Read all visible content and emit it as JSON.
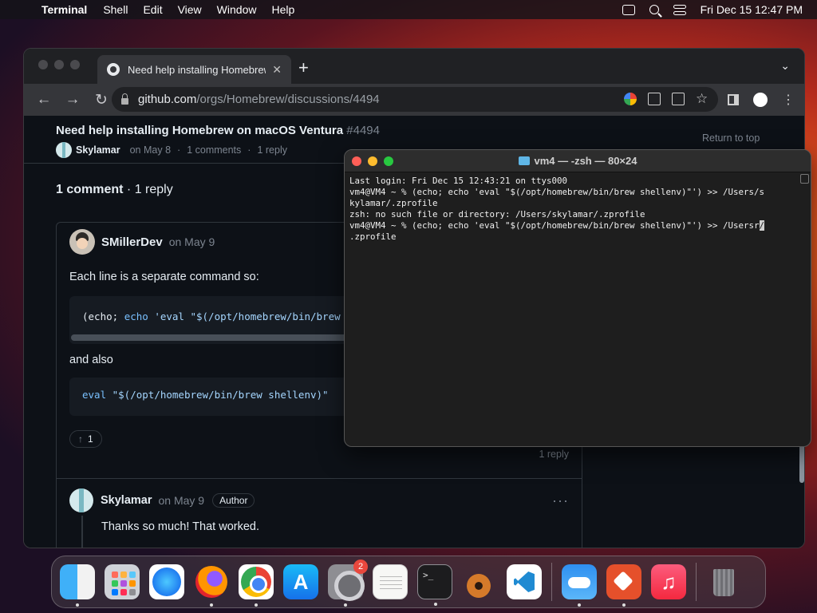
{
  "menubar": {
    "app_name": "Terminal",
    "menus": [
      "Shell",
      "Edit",
      "View",
      "Window",
      "Help"
    ],
    "clock": "Fri Dec 15  12:47 PM"
  },
  "browser": {
    "tab_title": "Need help installing Homebrew",
    "new_tab_label": "+",
    "url_host": "github.com",
    "url_path": "/orgs/Homebrew/discussions/4494"
  },
  "discussion": {
    "title": "Need help installing Homebrew on macOS Ventura",
    "number": "#4494",
    "author": "Skylamar",
    "date": "on May 8",
    "comments": "1 comments",
    "replies": "1 reply",
    "return_to_top": "Return to top",
    "count_bold": "1 comment",
    "count_rest": " · 1 reply"
  },
  "comment": {
    "user": "SMillerDev",
    "date": "on May 9",
    "text1": "Each line is a separate command so:",
    "code1_paren": "(echo; ",
    "code1_echo": "echo",
    "code1_rest": " 'eval \"$(/opt/homebrew/bin/brew shellenv)\"') >> /Users/skylamar/.zprofile",
    "text2": "and also",
    "code2_eval": "eval",
    "code2_rest": " \"$(/opt/homebrew/bin/brew shellenv)\"",
    "reaction_arrow": "↑",
    "reaction_count": "1",
    "reply_count": "1 reply"
  },
  "reply": {
    "user": "Skylamar",
    "date": "on May 9",
    "badge": "Author",
    "text": "Thanks so much! That worked.",
    "more": "···"
  },
  "terminal": {
    "title": "vm4 — -zsh — 80×24",
    "line1": "Last login: Fri Dec 15 12:43:21 on ttys000",
    "line2": "vm4@VM4 ~ % (echo; echo 'eval \"$(/opt/homebrew/bin/brew shellenv)\"') >> /Users/s",
    "line3": "kylamar/.zprofile",
    "line4": "zsh: no such file or directory: /Users/skylamar/.zprofile",
    "line5a": "vm4@VM4 ~ % (echo; echo 'eval \"$(/opt/homebrew/bin/brew shellenv)\"') >> /Usersr",
    "line5_cursor": "/",
    "line6": ".zprofile"
  },
  "dock": {
    "settings_badge": "2",
    "terminal_glyph": ">_",
    "appstore_glyph": "A",
    "music_glyph": "♫"
  }
}
